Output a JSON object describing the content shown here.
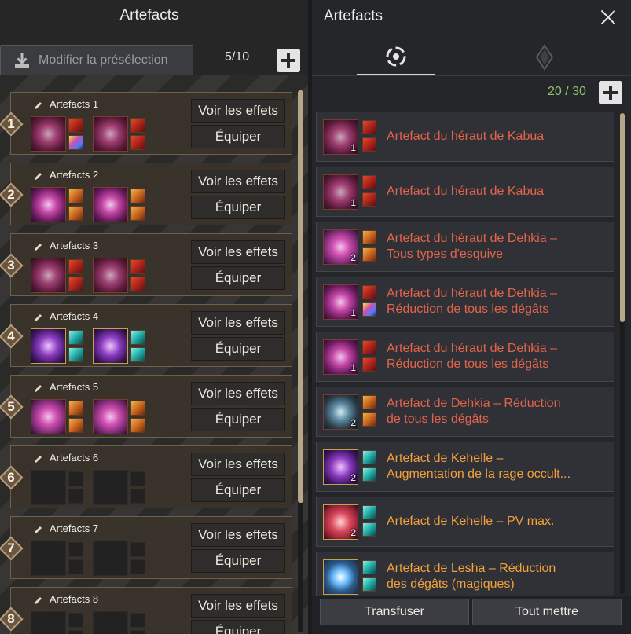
{
  "left": {
    "title": "Artefacts",
    "preset_button": "Modifier la présélection",
    "count": "5/10",
    "presets": [
      {
        "number": "1",
        "name": "Artefacts 1",
        "effects": "Voir les effets",
        "equip": "Équiper",
        "icon": "kabua-orb",
        "slots": [
          "red",
          "rainbow",
          "red",
          "red"
        ]
      },
      {
        "number": "2",
        "name": "Artefacts 2",
        "effects": "Voir les effets",
        "equip": "Équiper",
        "icon": "dehkia-orb",
        "slots": [
          "orange",
          "orange",
          "orange",
          "orange"
        ]
      },
      {
        "number": "3",
        "name": "Artefacts 3",
        "effects": "Voir les effets",
        "equip": "Équiper",
        "icon": "kabua-orb",
        "slots": [
          "red",
          "red",
          "red",
          "red"
        ]
      },
      {
        "number": "4",
        "name": "Artefacts 4",
        "effects": "Voir les effets",
        "equip": "Équiper",
        "icon": "kehelle-orb",
        "slots": [
          "teal",
          "teal",
          "teal",
          "teal"
        ]
      },
      {
        "number": "5",
        "name": "Artefacts 5",
        "effects": "Voir les effets",
        "equip": "Équiper",
        "icon": "box",
        "slots": [
          "orange",
          "orange",
          "orange",
          "orange"
        ]
      },
      {
        "number": "6",
        "name": "Artefacts 6",
        "effects": "Voir les effets",
        "equip": "Équiper",
        "icon": "empty",
        "slots": [
          "empty",
          "empty",
          "empty",
          "empty"
        ]
      },
      {
        "number": "7",
        "name": "Artefacts 7",
        "effects": "Voir les effets",
        "equip": "Équiper",
        "icon": "empty",
        "slots": [
          "empty",
          "empty",
          "empty",
          "empty"
        ]
      },
      {
        "number": "8",
        "name": "Artefacts 8",
        "effects": "Voir les effets",
        "equip": "Équiper",
        "icon": "empty",
        "slots": [
          "empty",
          "empty",
          "empty",
          "empty"
        ]
      }
    ]
  },
  "right": {
    "title": "Artefacts",
    "count": "20 / 30",
    "tabs": [
      "artifact-ring-tab",
      "diamond-tab"
    ],
    "items": [
      {
        "name": "Artefact du héraut de Kabua",
        "qty": "1",
        "color": "red",
        "icon": "kabua-orb",
        "slots": [
          "red",
          "red"
        ]
      },
      {
        "name": "Artefact du héraut de Kabua",
        "qty": "1",
        "color": "red",
        "icon": "kabua-orb",
        "slots": [
          "red",
          "red"
        ]
      },
      {
        "name": "Artefact du héraut de Dehkia –\nTous types d'esquive",
        "qty": "2",
        "color": "red",
        "icon": "box",
        "slots": [
          "orange",
          "orange"
        ]
      },
      {
        "name": "Artefact du héraut de Dehkia –\nRéduction de tous les dégâts",
        "qty": "1",
        "color": "red",
        "icon": "dehkia-orb",
        "slots": [
          "red",
          "rainbow"
        ]
      },
      {
        "name": "Artefact du héraut de Dehkia –\nRéduction de tous les dégâts",
        "qty": "1",
        "color": "red",
        "icon": "dehkia-orb",
        "slots": [
          "red",
          "red"
        ]
      },
      {
        "name": "Artefact de Dehkia – Réduction\nde tous les dégâts",
        "qty": "2",
        "color": "red",
        "icon": "dehkia2-orb",
        "slots": [
          "orange",
          "orange"
        ]
      },
      {
        "name": "Artefact de Kehelle –\nAugmentation de la rage occult...",
        "qty": "2",
        "color": "orange",
        "icon": "kehelle-orb",
        "slots": [
          "teal",
          "teal"
        ]
      },
      {
        "name": "Artefact de Kehelle – PV max.",
        "qty": "2",
        "color": "orange",
        "icon": "kehelle2-orb",
        "slots": [
          "teal",
          "teal"
        ]
      },
      {
        "name": "Artefact de Lesha – Réduction\ndes dégâts (magiques)",
        "qty": "",
        "color": "orange",
        "icon": "lesha-orb",
        "slots": [
          "teal",
          "teal"
        ]
      }
    ],
    "transfuse_button": "Transfuser",
    "put_all_button": "Tout mettre"
  },
  "colors": {
    "accent_gold": "#b7a68a",
    "count_green": "#8fc26b",
    "name_red": "#e3644a",
    "name_orange": "#f2a13c"
  }
}
